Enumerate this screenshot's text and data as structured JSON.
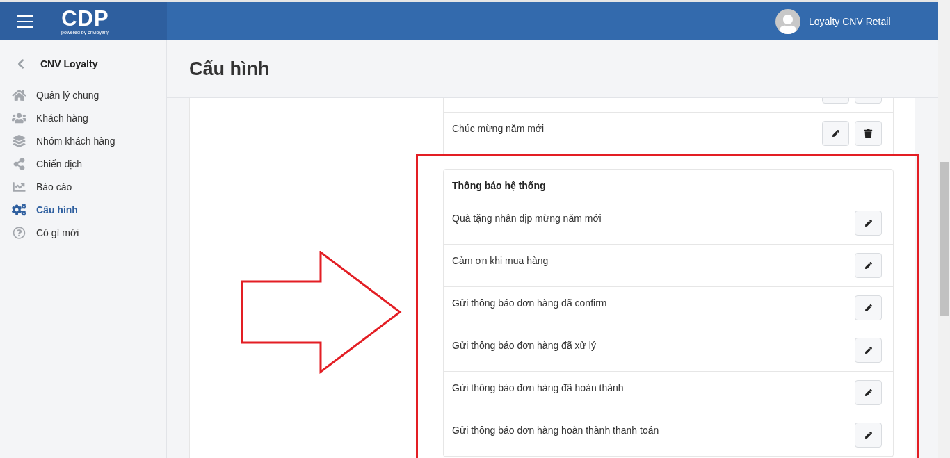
{
  "topbar": {
    "logo": "CDP",
    "logo_sub": "powered by cnvloyalty",
    "user": "Loyalty CNV Retail"
  },
  "sidebar": {
    "back_label": "CNV Loyalty",
    "items": [
      {
        "kind": "home",
        "label": "Quản lý chung",
        "selected": false
      },
      {
        "kind": "users",
        "label": "Khách hàng",
        "selected": false
      },
      {
        "kind": "layers",
        "label": "Nhóm khách hàng",
        "selected": false
      },
      {
        "kind": "share",
        "label": "Chiến dịch",
        "selected": false
      },
      {
        "kind": "chart",
        "label": "Báo cáo",
        "selected": false
      },
      {
        "kind": "gears",
        "label": "Cấu hình",
        "selected": true
      },
      {
        "kind": "help",
        "label": "Có gì mới",
        "selected": false
      }
    ]
  },
  "page_title": "Cấu hình",
  "cards": [
    {
      "cut_top": true,
      "deletable": true,
      "rows": [
        {},
        {
          "label": "Chúc mừng năm mới"
        }
      ]
    },
    {
      "cut_top": false,
      "deletable": false,
      "title": "Thông báo hệ thống",
      "rows": [
        {
          "label": "Quà tặng nhân dịp mừng năm mới"
        },
        {
          "label": "Cảm ơn khi mua hàng"
        },
        {
          "label": "Gửi thông báo đơn hàng đã confirm"
        },
        {
          "label": "Gửi thông báo đơn hàng đã xử lý"
        },
        {
          "label": "Gửi thông báo đơn hàng đã hoàn thành"
        },
        {
          "label": "Gửi thông báo đơn hàng hoàn thành thanh toán"
        }
      ]
    }
  ]
}
